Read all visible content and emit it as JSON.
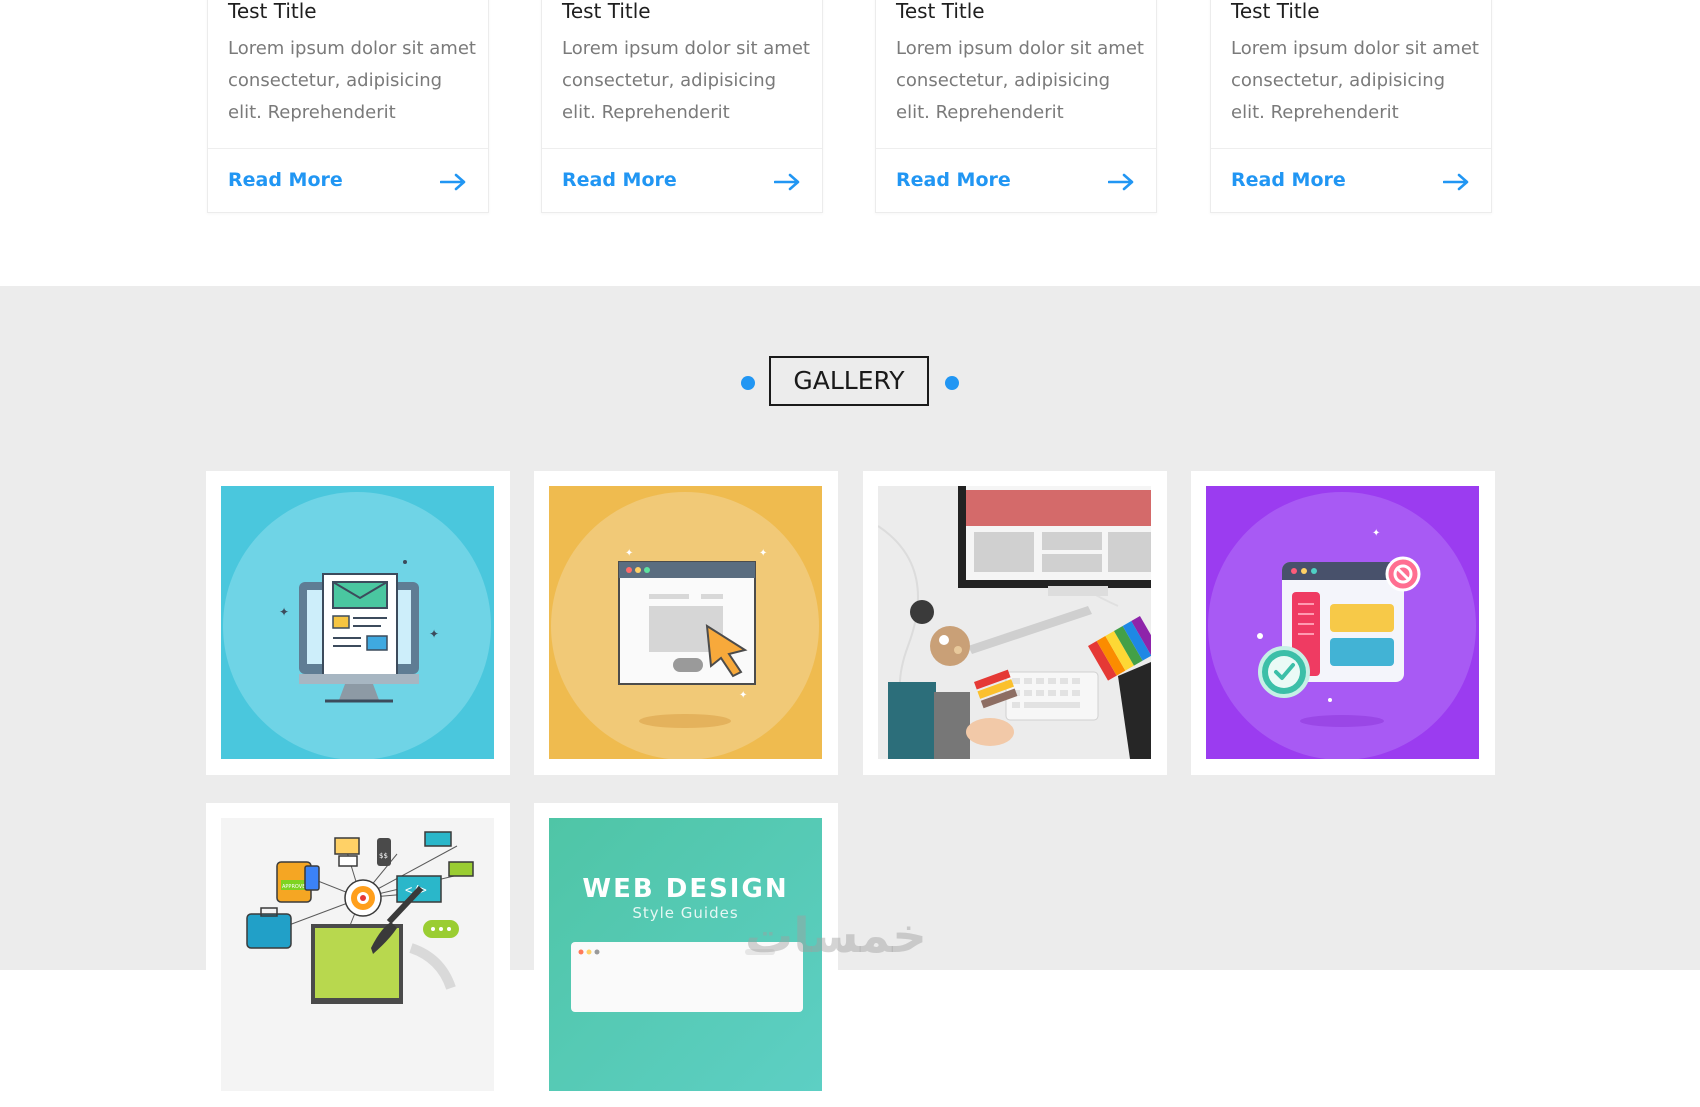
{
  "cards": [
    {
      "title": "Test Title",
      "desc": "Lorem ipsum dolor sit amet consectetur, adipisicing elit. Reprehenderit",
      "link": "Read More"
    },
    {
      "title": "Test Title",
      "desc": "Lorem ipsum dolor sit amet consectetur, adipisicing elit. Reprehenderit",
      "link": "Read More"
    },
    {
      "title": "Test Title",
      "desc": "Lorem ipsum dolor sit amet consectetur, adipisicing elit. Reprehenderit",
      "link": "Read More"
    },
    {
      "title": "Test Title",
      "desc": "Lorem ipsum dolor sit amet consectetur, adipisicing elit. Reprehenderit",
      "link": "Read More"
    }
  ],
  "gallery": {
    "heading": "GALLERY",
    "items": [
      {
        "name": "newsletter-monitor-illustration",
        "bg": "#4ac7dd"
      },
      {
        "name": "web-click-illustration",
        "bg": "#efbb4f"
      },
      {
        "name": "designer-desk-photo",
        "bg": "#e9e9e9"
      },
      {
        "name": "ui-approval-illustration",
        "bg": "#9b3cf0"
      },
      {
        "name": "digital-marketing-illustration",
        "bg": "#f4f4f4"
      },
      {
        "name": "web-design-style-guides",
        "bg": "#4fc5a6",
        "text_main": "WEB DESIGN",
        "text_sub": "Style Guides"
      }
    ]
  },
  "watermark": "خمسات",
  "colors": {
    "accent": "#2196f3",
    "text": "#1f1f1f",
    "muted": "#7a7a7a",
    "section_bg": "#ececec"
  }
}
